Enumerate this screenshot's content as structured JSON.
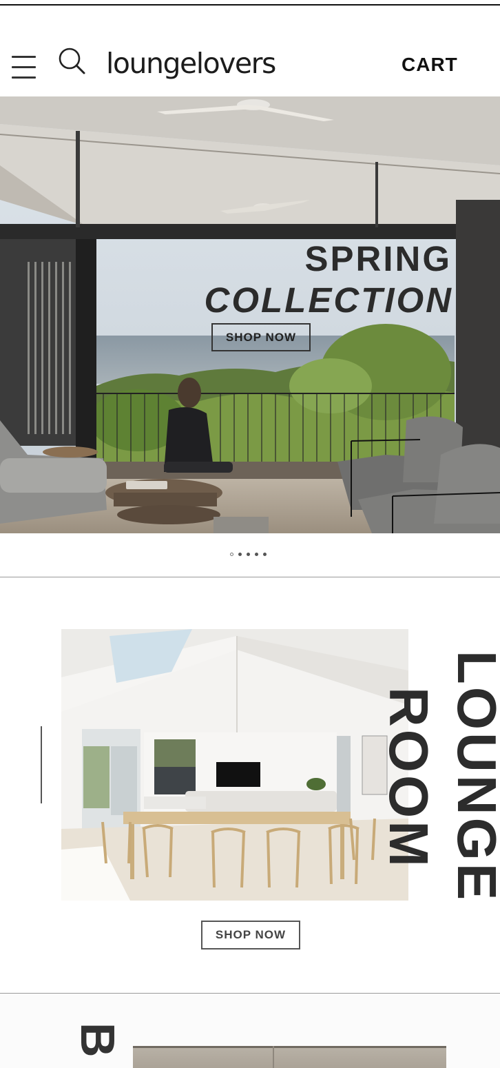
{
  "header": {
    "logo": "loungelovers",
    "cart_label": "CART",
    "menu_icon": "hamburger-menu-icon",
    "search_icon": "search-icon"
  },
  "hero": {
    "title_line1": "SPRING",
    "title_line2": "COLLECTION",
    "button_label": "SHOP NOW",
    "image": "living-room-ocean-view-photo",
    "slides": {
      "count": 5,
      "active_index": 0
    }
  },
  "lounge_room": {
    "vertical_label_1": "LOUNGE",
    "vertical_label_2": "ROOM",
    "button_label": "SHOP NOW",
    "image": "dining-room-vaulted-ceiling-photo"
  },
  "next_section": {
    "letter": "B"
  },
  "colors": {
    "text_dark": "#2b2b2b",
    "background": "#ffffff",
    "divider": "#999999"
  }
}
